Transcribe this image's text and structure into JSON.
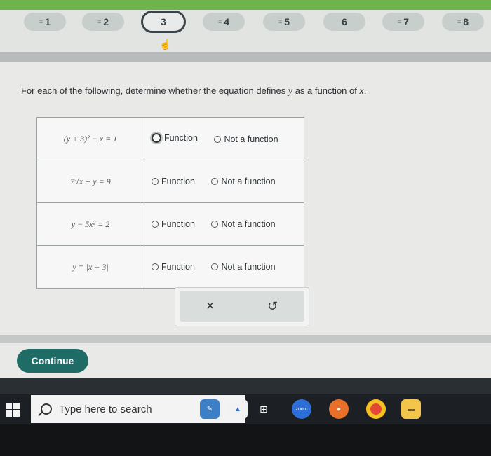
{
  "nav": {
    "questions": [
      {
        "label": "1",
        "state": "answered"
      },
      {
        "label": "2",
        "state": "answered"
      },
      {
        "label": "3",
        "state": "active"
      },
      {
        "label": "4",
        "state": "answered"
      },
      {
        "label": "5",
        "state": "answered"
      },
      {
        "label": "6",
        "state": "unanswered"
      },
      {
        "label": "7",
        "state": "answered"
      },
      {
        "label": "8",
        "state": "answered"
      }
    ]
  },
  "instructions": {
    "prefix": "For each of the following, determine whether the equation defines ",
    "var_y": "y",
    "middle": " as a function of ",
    "var_x": "x",
    "suffix": "."
  },
  "rows": [
    {
      "equation": "(y + 3)² − x = 1",
      "opt1": "Function",
      "opt2": "Not a function"
    },
    {
      "equation": "7√x + y = 9",
      "opt1": "Function",
      "opt2": "Not a function"
    },
    {
      "equation": "y − 5x² = 2",
      "opt1": "Function",
      "opt2": "Not a function"
    },
    {
      "equation": "y = |x + 3|",
      "opt1": "Function",
      "opt2": "Not a function"
    }
  ],
  "actions": {
    "clear": "×",
    "undo": "↺"
  },
  "continue_label": "Continue",
  "taskbar": {
    "search_placeholder": "Type here to search",
    "zoom_label": "zoom"
  }
}
